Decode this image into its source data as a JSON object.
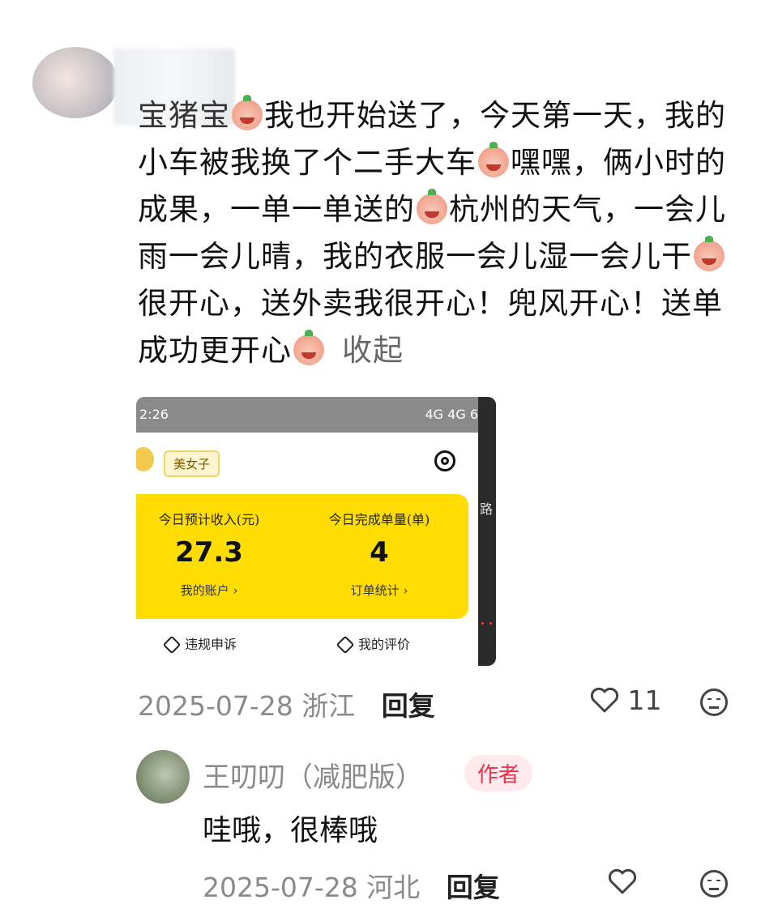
{
  "comment": {
    "username": "[redacted]",
    "body_parts": [
      "我也开始送了，今天第一天，我的小车被我换了个二手大车",
      "嘿嘿，俩小时的成果，一单一单送的",
      "杭州的天气，一会儿雨一会儿晴，我的衣服一会儿湿一会儿干",
      "很开心，送外卖我很开心！兜风开心！送单成功更开心"
    ],
    "prefix": "宝猪宝",
    "collapse_label": "收起",
    "date": "2025-07-28",
    "location": "浙江",
    "reply_label": "回复",
    "like_count": "11"
  },
  "screenshot": {
    "status_time": "2:26",
    "status_right": "4G 4G 6",
    "name_tag": "美女子",
    "stats": [
      {
        "label": "今日预计收入(元)",
        "value": "27.3",
        "link": "我的账户 ›"
      },
      {
        "label": "今日完成单量(单)",
        "value": "4",
        "link": "订单统计 ›"
      }
    ],
    "bottom": [
      {
        "label": "违规申诉"
      },
      {
        "label": "我的评价"
      }
    ],
    "side_text": "路"
  },
  "reply": {
    "username": "王叨叨（减肥版）",
    "badge": "作者",
    "text": "哇哦，很棒哦",
    "date": "2025-07-28",
    "location": "河北",
    "reply_label": "回复"
  },
  "icons": {
    "like": "heart-icon",
    "emoji_button": "face-icon",
    "settings": "settings-icon"
  }
}
